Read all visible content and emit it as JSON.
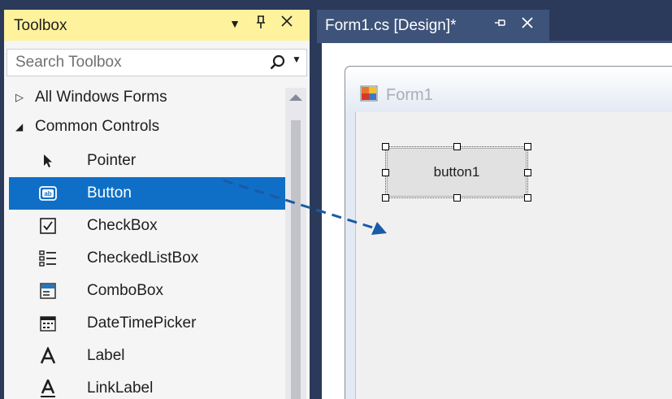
{
  "toolbox": {
    "title": "Toolbox",
    "header_buttons": {
      "dropdown": "▾",
      "pin": "ᵖ",
      "close": "✕"
    },
    "search": {
      "placeholder": "Search Toolbox"
    },
    "categories": [
      {
        "label": "All Windows Forms",
        "expanded": false,
        "arrow": "▷"
      },
      {
        "label": "Common Controls",
        "expanded": true,
        "arrow": "◢"
      }
    ],
    "tools": [
      {
        "label": "Pointer",
        "icon": "pointer-icon"
      },
      {
        "label": "Button",
        "icon": "button-icon",
        "selected": true
      },
      {
        "label": "CheckBox",
        "icon": "checkbox-icon"
      },
      {
        "label": "CheckedListBox",
        "icon": "checked-list-box-icon"
      },
      {
        "label": "ComboBox",
        "icon": "combo-box-icon"
      },
      {
        "label": "DateTimePicker",
        "icon": "date-time-picker-icon"
      },
      {
        "label": "Label",
        "icon": "label-icon"
      },
      {
        "label": "LinkLabel",
        "icon": "link-label-icon"
      }
    ]
  },
  "document": {
    "tab_title": "Form1.cs [Design]*",
    "tab_pin": "⊣",
    "tab_close": "✕"
  },
  "form": {
    "title": "Form1",
    "button_text": "button1"
  },
  "colors": {
    "toolbox_header": "#fff29d",
    "selection": "#0f6fc6",
    "ide_background": "#2b3a5a",
    "drag_arrow": "#1a5aa6"
  }
}
